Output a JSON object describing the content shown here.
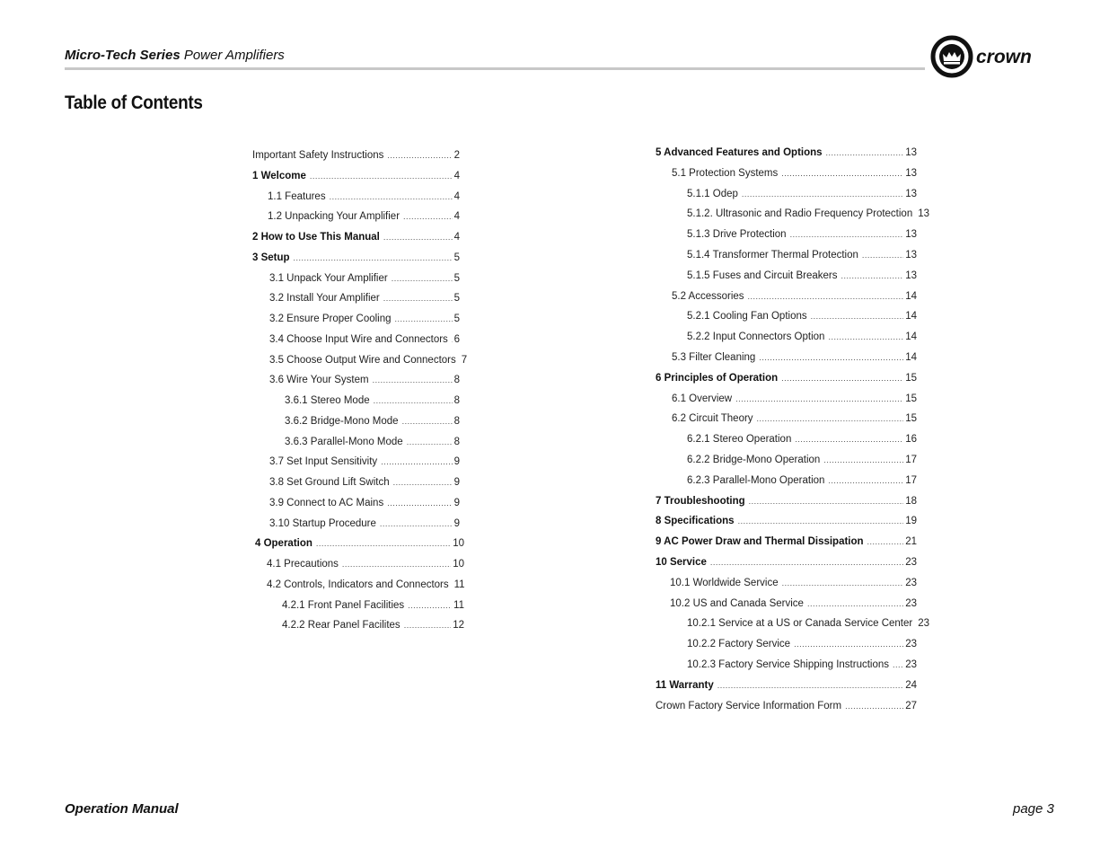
{
  "header": {
    "series_bold": "Micro-Tech Series",
    "series_rest": " Power Amplifiers",
    "logo_text": "crown"
  },
  "page_title": "Table of Contents",
  "toc_left": [
    {
      "label": "Important Safety Instructions",
      "page": "2",
      "bold": false,
      "indent": 0
    },
    {
      "label": "1 Welcome",
      "page": "4",
      "bold": true,
      "indent": 0
    },
    {
      "label": "1.1 Features",
      "page": "4",
      "bold": false,
      "indent": 1
    },
    {
      "label": "1.2 Unpacking Your Amplifier",
      "page": "4",
      "bold": false,
      "indent": 1
    },
    {
      "label": "2 How to Use This Manual",
      "page": "4",
      "bold": true,
      "indent": 0
    },
    {
      "label": "3 Setup",
      "page": "5",
      "bold": true,
      "indent": 0
    },
    {
      "label": "3.1 Unpack Your Amplifier",
      "page": "5",
      "bold": false,
      "indent": 1
    },
    {
      "label": "3.2 Install Your Amplifier",
      "page": "5",
      "bold": false,
      "indent": 1
    },
    {
      "label": "3.2 Ensure Proper Cooling",
      "page": "5",
      "bold": false,
      "indent": 1
    },
    {
      "label": "3.4 Choose Input Wire and Connectors",
      "page": "6",
      "bold": false,
      "indent": 1
    },
    {
      "label": "3.5 Choose Output Wire and Connectors",
      "page": "7",
      "bold": false,
      "indent": 1
    },
    {
      "label": "3.6 Wire Your System",
      "page": "8",
      "bold": false,
      "indent": 1
    },
    {
      "label": "3.6.1 Stereo Mode",
      "page": "8",
      "bold": false,
      "indent": 2
    },
    {
      "label": "3.6.2 Bridge-Mono Mode",
      "page": "8",
      "bold": false,
      "indent": 2
    },
    {
      "label": "3.6.3 Parallel-Mono Mode",
      "page": "8",
      "bold": false,
      "indent": 2
    },
    {
      "label": "3.7 Set Input Sensitivity",
      "page": "9",
      "bold": false,
      "indent": 1
    },
    {
      "label": "3.8 Set Ground Lift Switch",
      "page": "9",
      "bold": false,
      "indent": 1
    },
    {
      "label": "3.9 Connect to AC Mains",
      "page": "9",
      "bold": false,
      "indent": 1
    },
    {
      "label": "3.10 Startup Procedure",
      "page": "9",
      "bold": false,
      "indent": 1
    },
    {
      "label": "4 Operation",
      "page": "10",
      "bold": true,
      "indent": 0
    },
    {
      "label": "4.1 Precautions",
      "page": "10",
      "bold": false,
      "indent": 1
    },
    {
      "label": "4.2 Controls, Indicators and Connectors",
      "page": "11",
      "bold": false,
      "indent": 1
    },
    {
      "label": "4.2.1 Front Panel Facilities",
      "page": "11",
      "bold": false,
      "indent": 2
    },
    {
      "label": "4.2.2 Rear Panel Facilites",
      "page": "12",
      "bold": false,
      "indent": 2
    }
  ],
  "toc_right": [
    {
      "label": "5 Advanced Features and Options",
      "page": "13",
      "bold": true,
      "indent": 0
    },
    {
      "label": "5.1 Protection Systems",
      "page": "13",
      "bold": false,
      "indent": 1
    },
    {
      "label": "5.1.1 Odep",
      "page": "13",
      "bold": false,
      "indent": 2
    },
    {
      "label": "5.1.2. Ultrasonic and Radio Frequency Protection",
      "page": "13",
      "bold": false,
      "indent": 2
    },
    {
      "label": "5.1.3 Drive Protection",
      "page": "13",
      "bold": false,
      "indent": 2
    },
    {
      "label": "5.1.4 Transformer Thermal Protection",
      "page": "13",
      "bold": false,
      "indent": 2
    },
    {
      "label": "5.1.5 Fuses and Circuit Breakers",
      "page": "13",
      "bold": false,
      "indent": 2
    },
    {
      "label": "5.2 Accessories",
      "page": "14",
      "bold": false,
      "indent": 1
    },
    {
      "label": "5.2.1 Cooling Fan Options",
      "page": "14",
      "bold": false,
      "indent": 2
    },
    {
      "label": "5.2.2 Input Connectors  Option",
      "page": "14",
      "bold": false,
      "indent": 2
    },
    {
      "label": "5.3 Filter Cleaning",
      "page": "14",
      "bold": false,
      "indent": 1
    },
    {
      "label": "6 Principles of Operation",
      "page": "15",
      "bold": true,
      "indent": 0
    },
    {
      "label": "6.1 Overview",
      "page": "15",
      "bold": false,
      "indent": 1
    },
    {
      "label": "6.2 Circuit Theory",
      "page": "15",
      "bold": false,
      "indent": 1
    },
    {
      "label": "6.2.1 Stereo Operation",
      "page": "16",
      "bold": false,
      "indent": 2
    },
    {
      "label": "6.2.2 Bridge-Mono Operation",
      "page": "17",
      "bold": false,
      "indent": 2
    },
    {
      "label": "6.2.3 Parallel-Mono Operation",
      "page": "17",
      "bold": false,
      "indent": 2
    },
    {
      "label": "7 Troubleshooting",
      "page": "18",
      "bold": true,
      "indent": 0
    },
    {
      "label": "8 Specifications",
      "page": "19",
      "bold": true,
      "indent": 0
    },
    {
      "label": "9 AC Power Draw and Thermal Dissipation",
      "page": "21",
      "bold": true,
      "indent": 0
    },
    {
      "label": "10 Service",
      "page": "23",
      "bold": true,
      "indent": 0
    },
    {
      "label": "10.1 Worldwide Service",
      "page": "23",
      "bold": false,
      "indent": 1
    },
    {
      "label": "10.2 US and Canada Service",
      "page": "23",
      "bold": false,
      "indent": 1
    },
    {
      "label": "10.2.1 Service at a US or Canada Service Center",
      "page": "23",
      "bold": false,
      "indent": 2
    },
    {
      "label": "10.2.2 Factory Service",
      "page": "23",
      "bold": false,
      "indent": 2
    },
    {
      "label": "10.2.3 Factory Service Shipping Instructions",
      "page": "23",
      "bold": false,
      "indent": 2
    },
    {
      "label": "11 Warranty",
      "page": "24",
      "bold": true,
      "indent": 0
    },
    {
      "label": "Crown Factory Service Information Form",
      "page": "27",
      "bold": false,
      "indent": 0
    }
  ],
  "footer": {
    "left": "Operation Manual",
    "right": "page 3"
  }
}
